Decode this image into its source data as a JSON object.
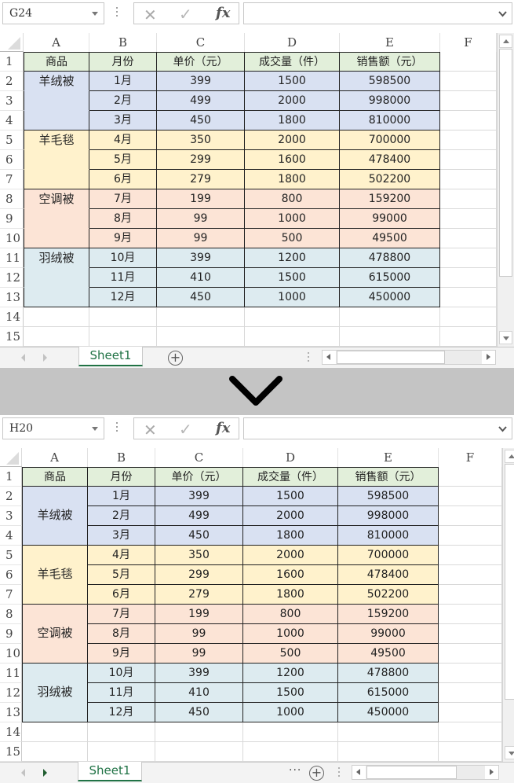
{
  "colors": {
    "header_fill": "#e2efda",
    "group_1_fill": "#d9e1f2",
    "group_2_fill": "#fff2cc",
    "group_3_fill": "#fce4d6",
    "group_4_fill": "#ddebf0",
    "sheet_tab_accent": "#217346",
    "divider_band": "#c4c4c4"
  },
  "icons": {
    "cancel": "✕",
    "confirm": "✓",
    "function": "fx",
    "add_sheet": "+",
    "ellipsis": "···"
  },
  "columns": [
    "A",
    "B",
    "C",
    "D",
    "E",
    "F"
  ],
  "row_numbers": [
    "1",
    "2",
    "3",
    "4",
    "5",
    "6",
    "7",
    "8",
    "9",
    "10",
    "11",
    "12",
    "13",
    "14",
    "15"
  ],
  "table": {
    "headers": [
      "商品",
      "月份",
      "单价（元）",
      "成交量（件）",
      "销售额（元）"
    ],
    "groups": [
      {
        "product": "羊绒被",
        "rows": [
          [
            "1月",
            "399",
            "1500",
            "598500"
          ],
          [
            "2月",
            "499",
            "2000",
            "998000"
          ],
          [
            "3月",
            "450",
            "1800",
            "810000"
          ]
        ]
      },
      {
        "product": "羊毛毯",
        "rows": [
          [
            "4月",
            "350",
            "2000",
            "700000"
          ],
          [
            "5月",
            "299",
            "1600",
            "478400"
          ],
          [
            "6月",
            "279",
            "1800",
            "502200"
          ]
        ]
      },
      {
        "product": "空调被",
        "rows": [
          [
            "7月",
            "199",
            "800",
            "159200"
          ],
          [
            "8月",
            "99",
            "1000",
            "99000"
          ],
          [
            "9月",
            "99",
            "500",
            "49500"
          ]
        ]
      },
      {
        "product": "羽绒被",
        "rows": [
          [
            "10月",
            "399",
            "1200",
            "478800"
          ],
          [
            "11月",
            "410",
            "1500",
            "615000"
          ],
          [
            "12月",
            "450",
            "1000",
            "450000"
          ]
        ]
      }
    ]
  },
  "before": {
    "name_box": "G24",
    "formula": "",
    "sheet_tab": "Sheet1",
    "merged_products": false
  },
  "after": {
    "name_box": "H20",
    "formula": "",
    "sheet_tab": "Sheet1",
    "merged_products": true
  }
}
